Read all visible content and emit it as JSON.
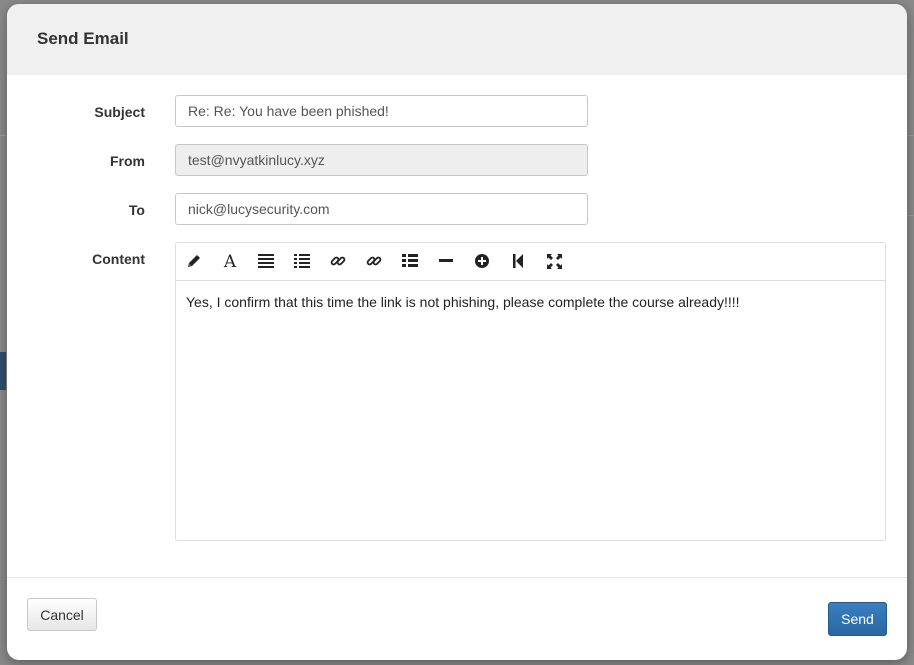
{
  "modal": {
    "title": "Send Email"
  },
  "form": {
    "subject_label": "Subject",
    "subject_value": "Re: Re: You have been phished!",
    "from_label": "From",
    "from_value": "test@nvyatkinlucy.xyz",
    "to_label": "To",
    "to_value": "nick@lucysecurity.com",
    "content_label": "Content"
  },
  "editor": {
    "toolbar": [
      {
        "icon": "pencil-icon"
      },
      {
        "icon": "font-icon"
      },
      {
        "icon": "align-justify-icon"
      },
      {
        "icon": "list-icon"
      },
      {
        "icon": "link-icon"
      },
      {
        "icon": "unlink-icon"
      },
      {
        "icon": "bulleted-list-icon"
      },
      {
        "icon": "horizontal-rule-icon"
      },
      {
        "icon": "circle-plus-icon"
      },
      {
        "icon": "skip-back-icon"
      },
      {
        "icon": "fullscreen-icon"
      }
    ],
    "content": "Yes, I confirm that this time the link is not phishing, please complete the course already!!!!"
  },
  "footer": {
    "cancel_label": "Cancel",
    "send_label": "Send"
  },
  "colors": {
    "send_button": "#2a67a3",
    "header_bg": "#f0f0f0"
  }
}
